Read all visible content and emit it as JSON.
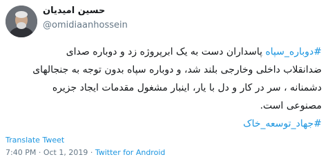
{
  "author": {
    "display_name": "حسین امیدیان",
    "handle": "@omidiaanhossein"
  },
  "tweet": {
    "hashtag_1": "#دوباره_سپاه",
    "line_1_rest": " پاسداران دست به یک ابرپروژه زد و دوباره صدای",
    "line_2": "ضدانقلاب داخلی وخارجی بلند شد، و دوباره سپاه بدون توجه به جنجالهای",
    "line_3": "دشمنانه ، سر در کار و دل با یار، اینبار مشغول مقدمات ایجاد جزیره",
    "line_4": "مصنوعی است.",
    "hashtag_2": "#جهاد_توسعه_خاک"
  },
  "translate_label": "Translate Tweet",
  "meta": {
    "time": "7:40 PM",
    "separator": " · ",
    "date": "Oct 1, 2019",
    "source": "Twitter for Android"
  },
  "icons": {
    "avatar": "profile-photo"
  }
}
